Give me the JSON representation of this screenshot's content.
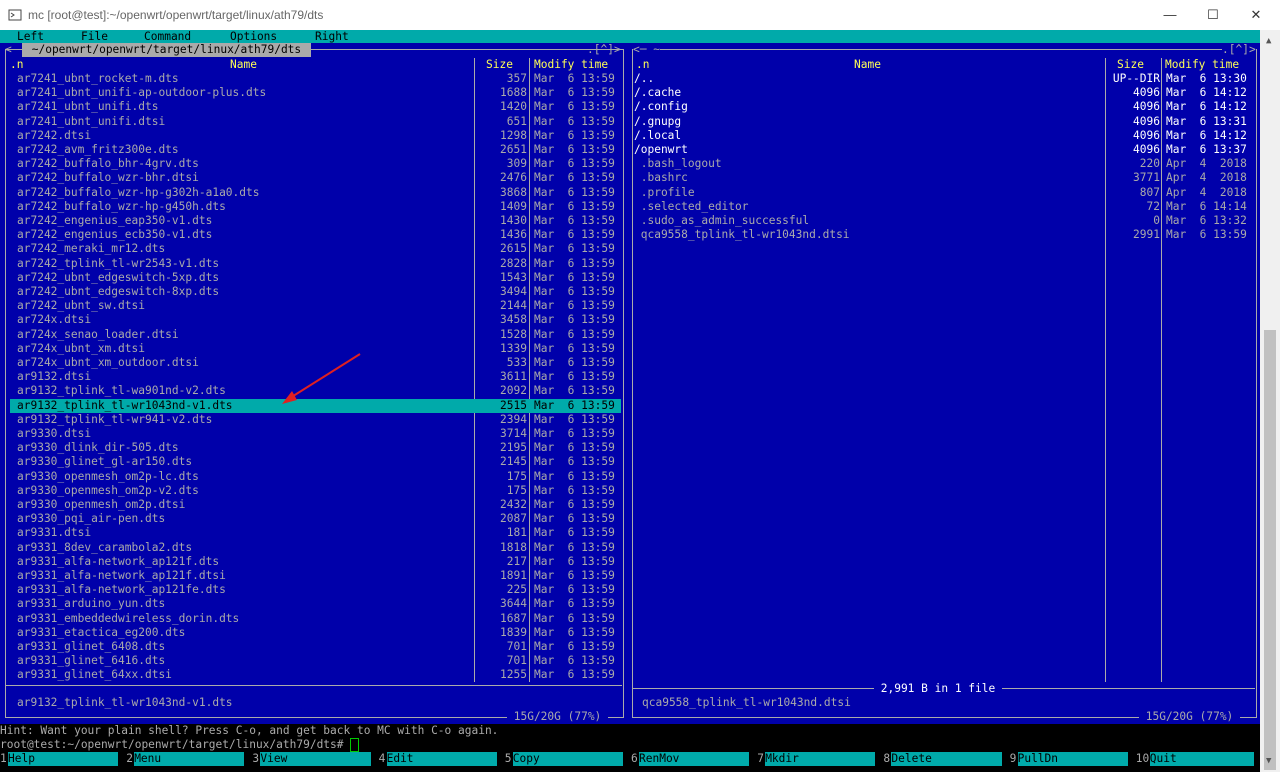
{
  "window": {
    "title": "mc [root@test]:~/openwrt/openwrt/target/linux/ath79/dts",
    "minimize": "—",
    "maximize": "☐",
    "close": "✕"
  },
  "menu": [
    "Left",
    "File",
    "Command",
    "Options",
    "Right"
  ],
  "left_panel": {
    "path": " ~/openwrt/openwrt/target/linux/ath79/dts ",
    "corner": ".[^]>",
    "corner_left": "<",
    "sort": ".n",
    "col_name": "Name",
    "col_size": "Size",
    "col_mtime": "Modify time",
    "files": [
      [
        "ar7241_ubnt_rocket-m.dts",
        "357",
        "Mar  6 13:59"
      ],
      [
        "ar7241_ubnt_unifi-ap-outdoor-plus.dts",
        "1688",
        "Mar  6 13:59"
      ],
      [
        "ar7241_ubnt_unifi.dts",
        "1420",
        "Mar  6 13:59"
      ],
      [
        "ar7241_ubnt_unifi.dtsi",
        "651",
        "Mar  6 13:59"
      ],
      [
        "ar7242.dtsi",
        "1298",
        "Mar  6 13:59"
      ],
      [
        "ar7242_avm_fritz300e.dts",
        "2651",
        "Mar  6 13:59"
      ],
      [
        "ar7242_buffalo_bhr-4grv.dts",
        "309",
        "Mar  6 13:59"
      ],
      [
        "ar7242_buffalo_wzr-bhr.dtsi",
        "2476",
        "Mar  6 13:59"
      ],
      [
        "ar7242_buffalo_wzr-hp-g302h-a1a0.dts",
        "3868",
        "Mar  6 13:59"
      ],
      [
        "ar7242_buffalo_wzr-hp-g450h.dts",
        "1409",
        "Mar  6 13:59"
      ],
      [
        "ar7242_engenius_eap350-v1.dts",
        "1430",
        "Mar  6 13:59"
      ],
      [
        "ar7242_engenius_ecb350-v1.dts",
        "1436",
        "Mar  6 13:59"
      ],
      [
        "ar7242_meraki_mr12.dts",
        "2615",
        "Mar  6 13:59"
      ],
      [
        "ar7242_tplink_tl-wr2543-v1.dts",
        "2828",
        "Mar  6 13:59"
      ],
      [
        "ar7242_ubnt_edgeswitch-5xp.dts",
        "1543",
        "Mar  6 13:59"
      ],
      [
        "ar7242_ubnt_edgeswitch-8xp.dts",
        "3494",
        "Mar  6 13:59"
      ],
      [
        "ar7242_ubnt_sw.dtsi",
        "2144",
        "Mar  6 13:59"
      ],
      [
        "ar724x.dtsi",
        "3458",
        "Mar  6 13:59"
      ],
      [
        "ar724x_senao_loader.dtsi",
        "1528",
        "Mar  6 13:59"
      ],
      [
        "ar724x_ubnt_xm.dtsi",
        "1339",
        "Mar  6 13:59"
      ],
      [
        "ar724x_ubnt_xm_outdoor.dtsi",
        "533",
        "Mar  6 13:59"
      ],
      [
        "ar9132.dtsi",
        "3611",
        "Mar  6 13:59"
      ],
      [
        "ar9132_tplink_tl-wa901nd-v2.dts",
        "2092",
        "Mar  6 13:59"
      ],
      [
        "ar9132_tplink_tl-wr1043nd-v1.dts",
        "2515",
        "Mar  6 13:59"
      ],
      [
        "ar9132_tplink_tl-wr941-v2.dts",
        "2394",
        "Mar  6 13:59"
      ],
      [
        "ar9330.dtsi",
        "3714",
        "Mar  6 13:59"
      ],
      [
        "ar9330_dlink_dir-505.dts",
        "2195",
        "Mar  6 13:59"
      ],
      [
        "ar9330_glinet_gl-ar150.dts",
        "2145",
        "Mar  6 13:59"
      ],
      [
        "ar9330_openmesh_om2p-lc.dts",
        "175",
        "Mar  6 13:59"
      ],
      [
        "ar9330_openmesh_om2p-v2.dts",
        "175",
        "Mar  6 13:59"
      ],
      [
        "ar9330_openmesh_om2p.dtsi",
        "2432",
        "Mar  6 13:59"
      ],
      [
        "ar9330_pqi_air-pen.dts",
        "2087",
        "Mar  6 13:59"
      ],
      [
        "ar9331.dtsi",
        "181",
        "Mar  6 13:59"
      ],
      [
        "ar9331_8dev_carambola2.dts",
        "1818",
        "Mar  6 13:59"
      ],
      [
        "ar9331_alfa-network_ap121f.dts",
        "217",
        "Mar  6 13:59"
      ],
      [
        "ar9331_alfa-network_ap121f.dtsi",
        "1891",
        "Mar  6 13:59"
      ],
      [
        "ar9331_alfa-network_ap121fe.dts",
        "225",
        "Mar  6 13:59"
      ],
      [
        "ar9331_arduino_yun.dts",
        "3644",
        "Mar  6 13:59"
      ],
      [
        "ar9331_embeddedwireless_dorin.dts",
        "1687",
        "Mar  6 13:59"
      ],
      [
        "ar9331_etactica_eg200.dts",
        "1839",
        "Mar  6 13:59"
      ],
      [
        "ar9331_glinet_6408.dts",
        "701",
        "Mar  6 13:59"
      ],
      [
        "ar9331_glinet_6416.dts",
        "701",
        "Mar  6 13:59"
      ],
      [
        "ar9331_glinet_64xx.dtsi",
        "1255",
        "Mar  6 13:59"
      ]
    ],
    "selected_index": 23,
    "mini_status": "ar9132_tplink_tl-wr1043nd-v1.dts",
    "disk": " 15G/20G (77%) "
  },
  "right_panel": {
    "path_marker": "<─ ~",
    "corner": ".[^]>",
    "sort": ".n",
    "col_name": "Name",
    "col_size": "Size",
    "col_mtime": "Modify time",
    "files": [
      [
        "/..",
        "UP--DIR",
        "Mar  6 13:30",
        "dir"
      ],
      [
        "/.cache",
        "4096",
        "Mar  6 14:12",
        "dir"
      ],
      [
        "/.config",
        "4096",
        "Mar  6 14:12",
        "dir"
      ],
      [
        "/.gnupg",
        "4096",
        "Mar  6 13:31",
        "dir"
      ],
      [
        "/.local",
        "4096",
        "Mar  6 14:12",
        "dir"
      ],
      [
        "/openwrt",
        "4096",
        "Mar  6 13:37",
        "dir"
      ],
      [
        " .bash_logout",
        "220",
        "Apr  4  2018",
        "file"
      ],
      [
        " .bashrc",
        "3771",
        "Apr  4  2018",
        "file"
      ],
      [
        " .profile",
        "807",
        "Apr  4  2018",
        "file"
      ],
      [
        " .selected_editor",
        "72",
        "Mar  6 14:14",
        "file"
      ],
      [
        " .sudo_as_admin_successful",
        "0",
        "Mar  6 13:32",
        "file"
      ],
      [
        " qca9558_tplink_tl-wr1043nd.dtsi",
        "2991",
        "Mar  6 13:59",
        "file"
      ]
    ],
    "summary": " 2,991 B in 1 file ",
    "mini_status": "qca9558_tplink_tl-wr1043nd.dtsi",
    "disk": " 15G/20G (77%) "
  },
  "hint": "Hint: Want your plain shell? Press C-o, and get back to MC with C-o again.",
  "prompt": "root@test:~/openwrt/openwrt/target/linux/ath79/dts# ",
  "fkeys": [
    [
      "1",
      "Help"
    ],
    [
      "2",
      "Menu"
    ],
    [
      "3",
      "View"
    ],
    [
      "4",
      "Edit"
    ],
    [
      "5",
      "Copy"
    ],
    [
      "6",
      "RenMov"
    ],
    [
      "7",
      "Mkdir"
    ],
    [
      "8",
      "Delete"
    ],
    [
      "9",
      "PullDn"
    ],
    [
      "10",
      "Quit"
    ]
  ],
  "colors": {
    "panel_bg": "#0000aa",
    "selection": "#00aaaa",
    "header_yellow": "#ffff55",
    "annotation_arrow": "#e02020"
  }
}
